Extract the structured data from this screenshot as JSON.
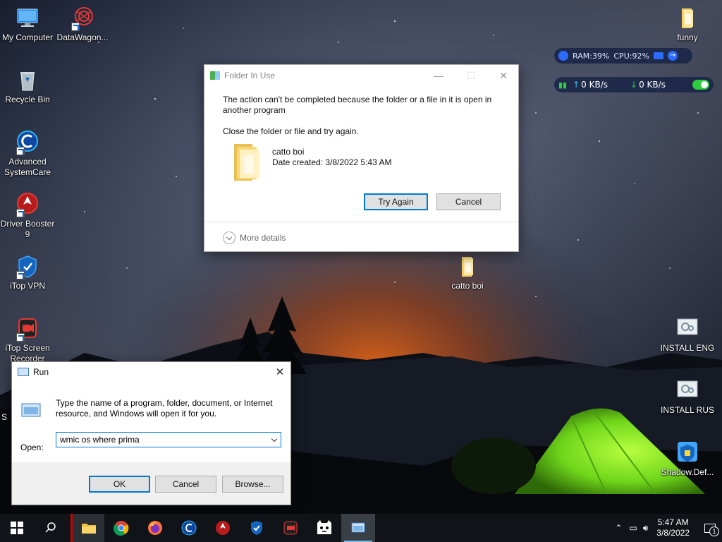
{
  "desktop": {
    "icons_left": [
      {
        "label": "My Computer",
        "icon": "computer-icon"
      },
      {
        "label": "DataWagon...",
        "icon": "datawagon-icon"
      },
      {
        "label": "Recycle Bin",
        "icon": "recycle-bin-icon"
      },
      {
        "label": "Advanced SystemCare",
        "icon": "advanced-systemcare-icon"
      },
      {
        "label": "Driver Booster 9",
        "icon": "driver-booster-icon"
      },
      {
        "label": "iTop VPN",
        "icon": "itop-vpn-icon"
      },
      {
        "label": "iTop Screen Recorder",
        "icon": "itop-screen-recorder-icon"
      }
    ],
    "partial_label": "S",
    "icons_right": [
      {
        "label": "funny",
        "icon": "folder-icon"
      },
      {
        "label": "catto boi",
        "icon": "folder-icon"
      },
      {
        "label": "INSTALL ENG",
        "icon": "installer-icon"
      },
      {
        "label": "INSTALL RUS",
        "icon": "installer-icon"
      },
      {
        "label": "Shadow.Def...",
        "icon": "shadow-defender-icon"
      }
    ]
  },
  "monitor": {
    "ram_label": "RAM:",
    "ram_value": "39%",
    "cpu_label": "CPU:",
    "cpu_value": "92%",
    "upload": "0 KB/s",
    "download": "0 KB/s"
  },
  "folder_dialog": {
    "title": "Folder In Use",
    "message": "The action can't be completed because the folder or a file in it is open in another program",
    "instruction": "Close the folder or file and try again.",
    "file_name": "catto boi",
    "date_created": "Date created: 3/8/2022 5:43 AM",
    "try_again": "Try Again",
    "cancel": "Cancel",
    "more_details": "More details"
  },
  "run_dialog": {
    "title": "Run",
    "description": "Type the name of a program, folder, document, or Internet resource, and Windows will open it for you.",
    "open_label": "Open:",
    "input_value": "wmic os where prima",
    "ok": "OK",
    "cancel": "Cancel",
    "browse": "Browse..."
  },
  "taskbar": {
    "apps": [
      "file-explorer-icon",
      "chrome-icon",
      "firefox-icon",
      "advanced-systemcare-icon",
      "driver-booster-icon",
      "itop-vpn-icon",
      "itop-screen-recorder-icon",
      "cat-app-icon",
      "run-app-icon"
    ],
    "time": "5:47 AM",
    "date": "3/8/2022",
    "notification_count": "1"
  },
  "colors": {
    "accent": "#0078d7",
    "taskbar": "#101418"
  }
}
